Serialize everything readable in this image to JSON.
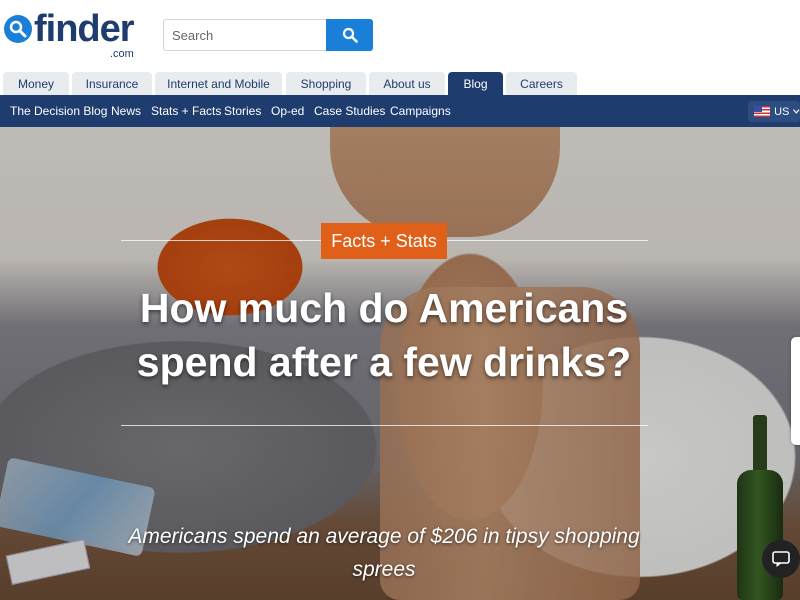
{
  "header": {
    "logo_text": "finder",
    "logo_sub": ".com",
    "search_placeholder": "Search"
  },
  "tabs": [
    {
      "label": "Money",
      "active": false
    },
    {
      "label": "Insurance",
      "active": false
    },
    {
      "label": "Internet and Mobile",
      "active": false
    },
    {
      "label": "Shopping",
      "active": false
    },
    {
      "label": "About us",
      "active": false
    },
    {
      "label": "Blog",
      "active": true
    },
    {
      "label": "Careers",
      "active": false
    }
  ],
  "subnav": {
    "items": [
      "The Decision Blog",
      "News",
      "Stats + Facts",
      "Stories",
      "Op-ed",
      "Case Studies",
      "Campaigns"
    ],
    "locale": "US"
  },
  "hero": {
    "category": "Facts + Stats",
    "headline": "How much do Americans spend after a few drinks?",
    "subheadline": "Americans spend an average of $206 in tipsy shopping sprees"
  },
  "icons": {
    "search": "search-icon",
    "chat": "chat-icon",
    "flag": "us-flag-icon",
    "chevron": "chevron-down-icon"
  },
  "colors": {
    "brand_navy": "#1e3c6e",
    "brand_blue": "#1a7fd9",
    "category_orange": "#e0601a"
  }
}
